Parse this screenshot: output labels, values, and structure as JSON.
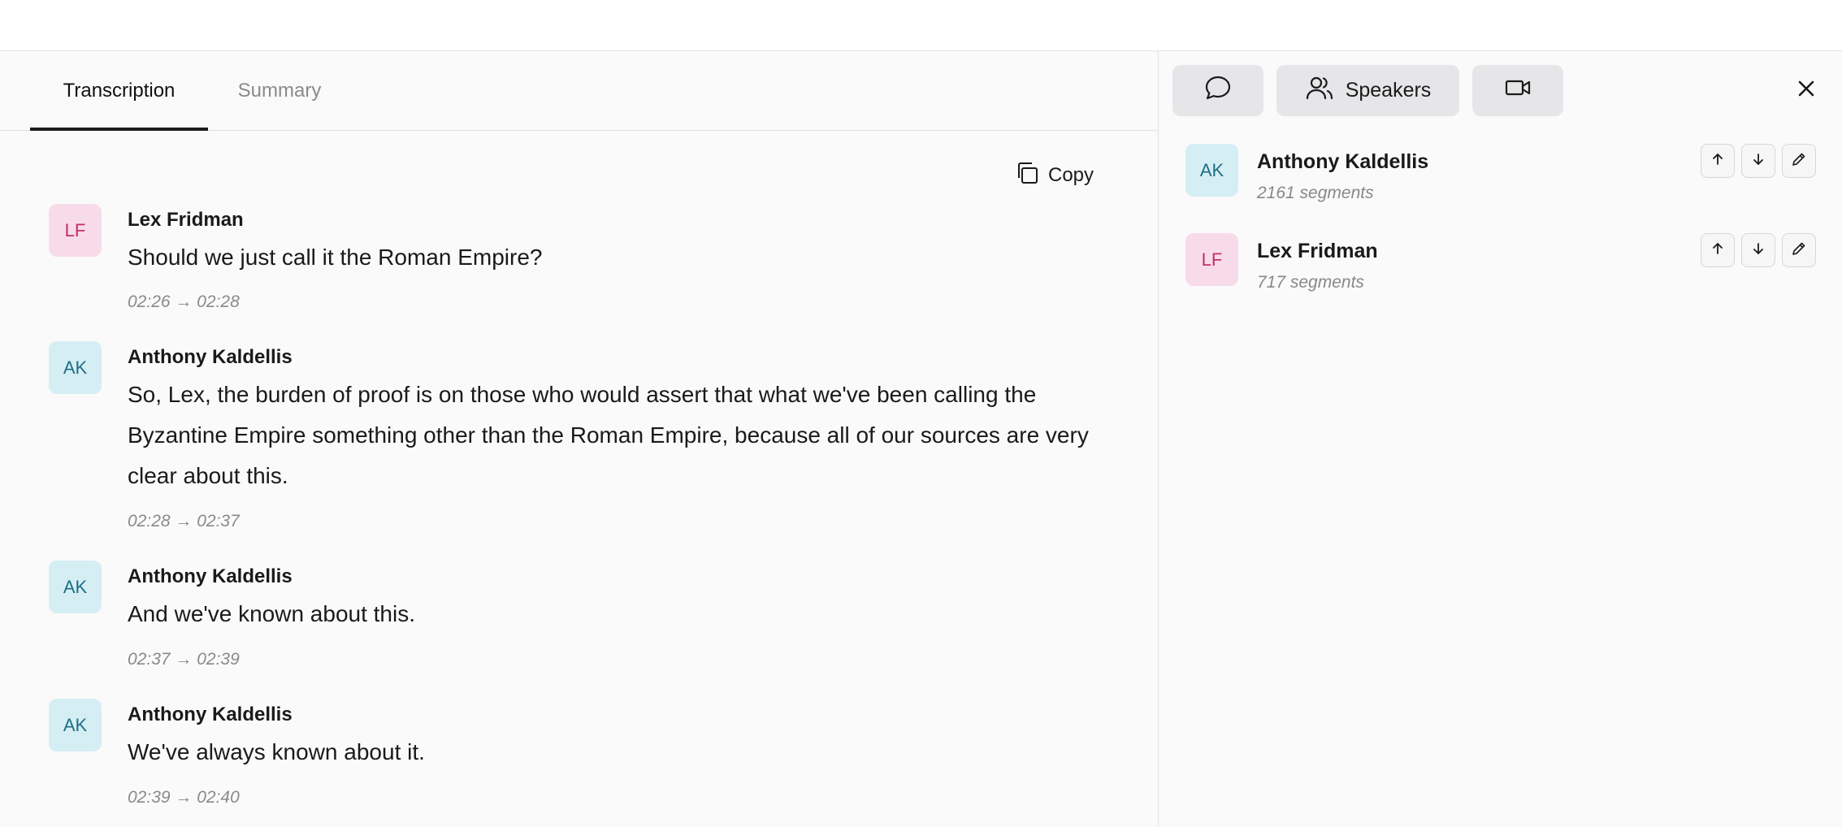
{
  "tabs": [
    {
      "label": "Transcription",
      "active": true
    },
    {
      "label": "Summary",
      "active": false
    }
  ],
  "copy_label": "Copy",
  "transcript": [
    {
      "initials": "LF",
      "speaker": "Lex Fridman",
      "text": "Should we just call it the Roman Empire?",
      "time": "02:26 → 02:28"
    },
    {
      "initials": "AK",
      "speaker": "Anthony Kaldellis",
      "text": "So, Lex, the burden of proof is on those who would assert that what we've been calling the Byzantine Empire something other than the Roman Empire, because all of our sources are very clear about this.",
      "time": "02:28 → 02:37"
    },
    {
      "initials": "AK",
      "speaker": "Anthony Kaldellis",
      "text": "And we've known about this.",
      "time": "02:37 → 02:39"
    },
    {
      "initials": "AK",
      "speaker": "Anthony Kaldellis",
      "text": "We've always known about it.",
      "time": "02:39 → 02:40"
    }
  ],
  "right_panel": {
    "buttons": [
      {
        "icon": "chat-bubble-icon",
        "label": ""
      },
      {
        "icon": "users-icon",
        "label": "Speakers"
      },
      {
        "icon": "video-camera-icon",
        "label": ""
      }
    ],
    "speakers": [
      {
        "initials": "AK",
        "name": "Anthony Kaldellis",
        "count": "2161 segments"
      },
      {
        "initials": "LF",
        "name": "Lex Fridman",
        "count": "717 segments"
      }
    ]
  },
  "colors": {
    "lf_bg": "#f8dbe8",
    "lf_fg": "#c0306e",
    "ak_bg": "#d5eef4",
    "ak_fg": "#1f6f85"
  }
}
